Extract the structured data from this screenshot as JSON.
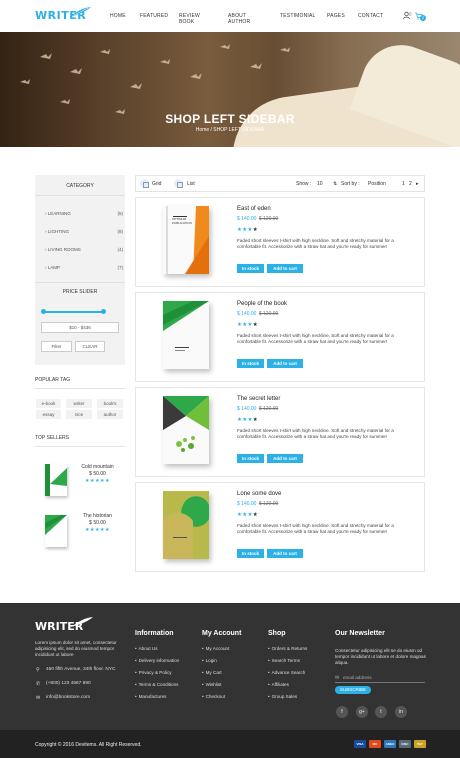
{
  "brand": {
    "logo": "WRITER"
  },
  "nav": {
    "items": [
      "HOME",
      "FEATURED",
      "REVIEW BOOK",
      "ABOUT AUTHOR",
      "TESTIMONIAL",
      "PAGES",
      "CONTACT"
    ],
    "cart_count": "2"
  },
  "hero": {
    "title": "SHOP LEFT SIDEBAR",
    "breadcrumb": "Home / SHOP LEFT SIDEBAR"
  },
  "sidebar": {
    "category_title": "CATEGORY",
    "categories": [
      {
        "label": "LEARNING",
        "count": "(5)"
      },
      {
        "label": "LIGHTING",
        "count": "(8)"
      },
      {
        "label": "LIVING ROOMS",
        "count": "(4)"
      },
      {
        "label": "LAMP",
        "count": "(7)"
      }
    ],
    "price_title": "PRICE SLIDER",
    "price_range": "$10 - $436",
    "price_slider": {
      "min_fraction": 0.0,
      "max_fraction": 1.0
    },
    "filter_label": "Filter",
    "clear_label": "CLEAR",
    "tags_title": "POPULAR TAG",
    "tags": [
      "e-book",
      "writer",
      "book's",
      "essay",
      "nice",
      "author"
    ],
    "sellers_title": "TOP SELLERS",
    "sellers": [
      {
        "name": "Cold mountain",
        "price": "$ 50.00",
        "stars": "★★★★★"
      },
      {
        "name": "The historian",
        "price": "$ 50.00",
        "stars": "★★★★★"
      }
    ]
  },
  "toolbar": {
    "grid_label": "Grid",
    "list_label": "List",
    "show_label": "Show :",
    "show_value": "10",
    "sort_label": "Sort by :",
    "sort_value": "Position",
    "pages": [
      "1",
      "2"
    ]
  },
  "products": [
    {
      "title": "East of eden",
      "price": "$ 140.00",
      "old_price": "$ 120.00",
      "rating": 4,
      "desc": "Faded short sleeves t-shirt with high neckline. Soft and stretchy material for a comfortable fit. Accessorize with a straw hat and you're ready for summer!",
      "cover_label": "OPTIMUM PUBLICATION"
    },
    {
      "title": "People of the book",
      "price": "$ 140.00",
      "old_price": "$ 120.00",
      "rating": 4,
      "desc": "Faded short sleeves t-shirt with high neckline. Soft and stretchy material for a comfortable fit. Accessorize with a straw hat and you're ready for summer!",
      "cover_label": ""
    },
    {
      "title": "The secret letter",
      "price": "$ 140.00",
      "old_price": "$ 120.00",
      "rating": 4,
      "desc": "Faded short sleeves t-shirt with high neckline. Soft and stretchy material for a comfortable fit. Accessorize with a straw hat and you're ready for summer!",
      "cover_label": ""
    },
    {
      "title": "Lone some dove",
      "price": "$ 140.00",
      "old_price": "$ 120.00",
      "rating": 4,
      "desc": "Faded short sleeves t-shirt with high neckline. Soft and stretchy material for a comfortable fit. Accessorize with a straw hat and you're ready for summer!",
      "cover_label": ""
    }
  ],
  "product_buttons": {
    "stock": "In stock",
    "cart": "Add to cart"
  },
  "footer": {
    "logo": "WRITER",
    "about": "Lorem ipsum dolor sit amet, consectetur adipisicing elit, sed do eiusmod tempor incididunt ut labore",
    "address": "450 fifth Avenue, 34th floor. NYC",
    "phone": "(+800) 123 4567 890",
    "email": "info@bookstore.com",
    "columns": [
      {
        "title": "Information",
        "links": [
          "About Us",
          "Delivery information",
          "Privacy & Policy",
          "Terms & Conditions",
          "Manufactures"
        ]
      },
      {
        "title": "My Account",
        "links": [
          "My Account",
          "Login",
          "My Cart",
          "Wishlist",
          "Checkout"
        ]
      },
      {
        "title": "Shop",
        "links": [
          "Orders & Returns",
          "Search Terms",
          "Advance Search",
          "Affiliates",
          "Group Sales"
        ]
      }
    ],
    "newsletter": {
      "title": "Our Newsletter",
      "text": "Consectetur adipisicing elit se do eiusm od tempor incididunt ut labore et dolore magnas aliqua.",
      "placeholder": "email address",
      "button": "SUBSCRIBE"
    },
    "social": [
      "f",
      "g+",
      "t",
      "in"
    ],
    "copyright": "Copyright © 2016 Devitems. All Right Reserved.",
    "payments": [
      "VISA",
      "MC",
      "AMEX",
      "DISC",
      "PAY"
    ]
  },
  "colors": {
    "accent": "#2bb1e6",
    "footer": "#333333",
    "footer_bottom": "#222222"
  }
}
